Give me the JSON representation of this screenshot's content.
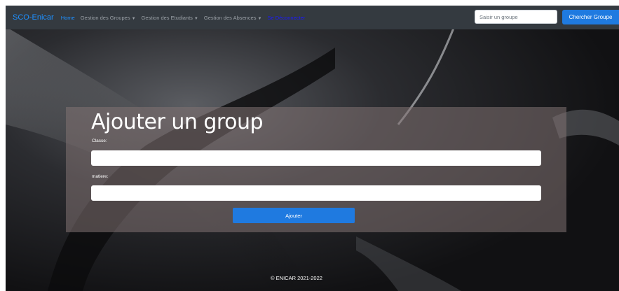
{
  "navbar": {
    "brand": "SCO-Enicar",
    "links": [
      {
        "label": "Home"
      },
      {
        "label": "Gestion des Groupes"
      },
      {
        "label": "Gestion des Etudiants"
      },
      {
        "label": "Gestion des Absences"
      },
      {
        "label": "Se Déconnecter"
      }
    ],
    "search": {
      "placeholder": "Saisir un groupe",
      "button_label": "Chercher Groupe"
    }
  },
  "form": {
    "title": "Ajouter un group",
    "classe_label": "Classe:",
    "matiere_label": "matiere:",
    "classe_value": "",
    "matiere_value": "",
    "submit_label": "Ajouter"
  },
  "footer": {
    "text": "© ENICAR 2021-2022"
  },
  "colors": {
    "navbar_bg": "#343a40",
    "accent": "#1f7ae0",
    "brand": "#1e90ff"
  }
}
